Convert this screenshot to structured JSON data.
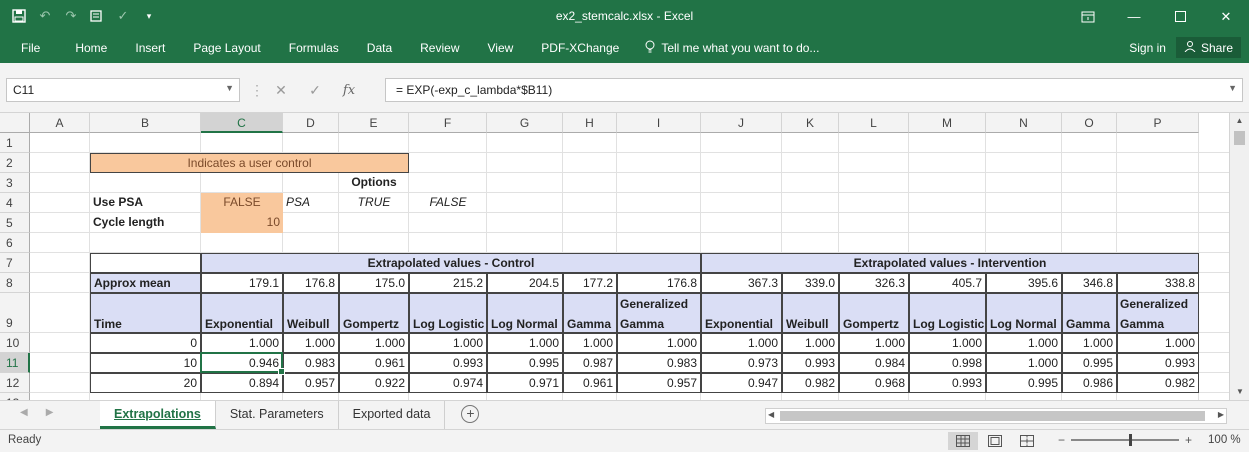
{
  "window": {
    "title": "ex2_stemcalc.xlsx - Excel",
    "quick_access": [
      "save-icon",
      "undo-icon",
      "redo-icon",
      "form-icon",
      "check-icon",
      "customize-icon"
    ],
    "controls": [
      "ribbon-display-icon",
      "minimize-icon",
      "maximize-icon",
      "close-icon"
    ]
  },
  "ribbon": {
    "tabs": [
      "File",
      "Home",
      "Insert",
      "Page Layout",
      "Formulas",
      "Data",
      "Review",
      "View",
      "PDF-XChange"
    ],
    "tell_me": "Tell me what you want to do...",
    "sign_in": "Sign in",
    "share": "Share"
  },
  "formula_bar": {
    "name_box": "C11",
    "formula": "= EXP(-exp_c_lambda*$B11)"
  },
  "columns": [
    "A",
    "B",
    "C",
    "D",
    "E",
    "F",
    "G",
    "H",
    "I",
    "J",
    "K",
    "L",
    "M",
    "N",
    "O",
    "P"
  ],
  "rows": [
    "1",
    "2",
    "3",
    "4",
    "5",
    "6",
    "7",
    "8",
    "9",
    "10",
    "11",
    "12",
    "13"
  ],
  "sheet": {
    "legend": "Indicates a user control",
    "options_label": "Options",
    "use_psa_label": "Use PSA",
    "use_psa_value": "FALSE",
    "psa_option": "PSA",
    "true_option": "TRUE",
    "false_option": "FALSE",
    "cycle_length_label": "Cycle length",
    "cycle_length_value": "10",
    "control_header": "Extrapolated values - Control",
    "intervention_header": "Extrapolated values - Intervention",
    "approx_mean_label": "Approx mean",
    "time_label": "Time",
    "dist_names": [
      "Exponential",
      "Weibull",
      "Gompertz",
      "Log Logistic",
      "Log Normal",
      "Gamma",
      "Generalized Gamma"
    ],
    "mean_control": [
      "179.1",
      "176.8",
      "175.0",
      "215.2",
      "204.5",
      "177.2",
      "176.8"
    ],
    "mean_intervention": [
      "367.3",
      "339.0",
      "326.3",
      "405.7",
      "395.6",
      "346.8",
      "338.8"
    ],
    "data_rows": [
      {
        "time": "0",
        "control": [
          "1.000",
          "1.000",
          "1.000",
          "1.000",
          "1.000",
          "1.000",
          "1.000"
        ],
        "intervention": [
          "1.000",
          "1.000",
          "1.000",
          "1.000",
          "1.000",
          "1.000",
          "1.000"
        ]
      },
      {
        "time": "10",
        "control": [
          "0.946",
          "0.983",
          "0.961",
          "0.993",
          "0.995",
          "0.987",
          "0.983"
        ],
        "intervention": [
          "0.973",
          "0.993",
          "0.984",
          "0.998",
          "1.000",
          "0.995",
          "0.993"
        ]
      },
      {
        "time": "20",
        "control": [
          "0.894",
          "0.957",
          "0.922",
          "0.974",
          "0.971",
          "0.961",
          "0.957"
        ],
        "intervention": [
          "0.947",
          "0.982",
          "0.968",
          "0.993",
          "0.995",
          "0.986",
          "0.982"
        ]
      }
    ]
  },
  "sheet_tabs": [
    "Extrapolations",
    "Stat. Parameters",
    "Exported data"
  ],
  "status": {
    "ready": "Ready",
    "zoom": "100 %"
  }
}
